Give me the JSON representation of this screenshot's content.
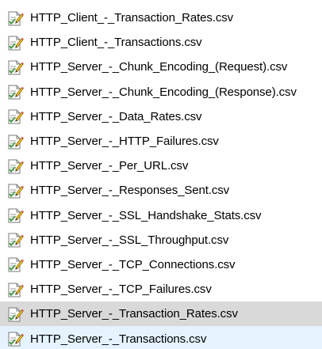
{
  "files": [
    {
      "name": "HTTP_Client_-_Transaction_Rates.csv",
      "icon": "csv-file-icon",
      "state": "normal"
    },
    {
      "name": "HTTP_Client_-_Transactions.csv",
      "icon": "csv-file-icon",
      "state": "normal"
    },
    {
      "name": "HTTP_Server_-_Chunk_Encoding_(Request).csv",
      "icon": "csv-file-icon",
      "state": "normal"
    },
    {
      "name": "HTTP_Server_-_Chunk_Encoding_(Response).csv",
      "icon": "csv-file-icon",
      "state": "normal"
    },
    {
      "name": "HTTP_Server_-_Data_Rates.csv",
      "icon": "csv-file-icon",
      "state": "normal"
    },
    {
      "name": "HTTP_Server_-_HTTP_Failures.csv",
      "icon": "csv-file-icon",
      "state": "normal"
    },
    {
      "name": "HTTP_Server_-_Per_URL.csv",
      "icon": "csv-file-icon",
      "state": "normal"
    },
    {
      "name": "HTTP_Server_-_Responses_Sent.csv",
      "icon": "csv-file-icon",
      "state": "normal"
    },
    {
      "name": "HTTP_Server_-_SSL_Handshake_Stats.csv",
      "icon": "csv-file-icon",
      "state": "normal"
    },
    {
      "name": "HTTP_Server_-_SSL_Throughput.csv",
      "icon": "csv-file-icon",
      "state": "normal"
    },
    {
      "name": "HTTP_Server_-_TCP_Connections.csv",
      "icon": "csv-file-icon",
      "state": "normal"
    },
    {
      "name": "HTTP_Server_-_TCP_Failures.csv",
      "icon": "csv-file-icon",
      "state": "normal"
    },
    {
      "name": "HTTP_Server_-_Transaction_Rates.csv",
      "icon": "csv-file-icon",
      "state": "selected-inactive"
    },
    {
      "name": "HTTP_Server_-_Transactions.csv",
      "icon": "csv-file-icon",
      "state": "hover"
    }
  ],
  "colors": {
    "selected_inactive_bg": "#d9d9d9",
    "hover_bg": "#e5f3ff",
    "icon_pencil_yellow": "#f2c12e",
    "icon_check_green": "#3a9a3a"
  }
}
